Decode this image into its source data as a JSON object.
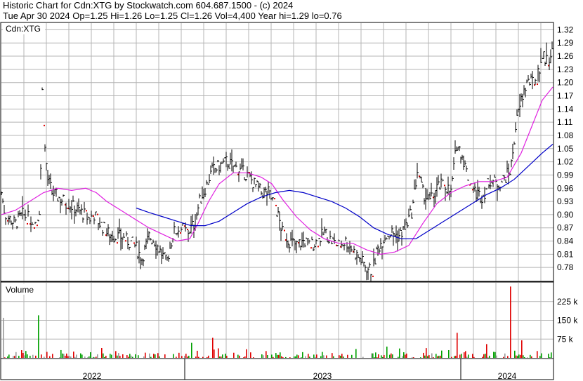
{
  "header": {
    "line1": "Historic Chart for Cdn:XTG by Stockwatch.com 604.687.1500 - (c) 2024",
    "line2": "Tue Apr 30 2024  Op=1.25  Hi=1.26  Lo=1.25  Cl=1.26  Vol=4,400  Year hi=1.29  lo=0.76"
  },
  "chart_data": [
    {
      "type": "ohlc",
      "panel_label": "Cdn:XTG",
      "y_ticks": [
        "1.32",
        "1.29",
        "1.26",
        "1.23",
        "1.20",
        "1.17",
        "1.14",
        "1.11",
        "1.08",
        "1.05",
        "1.02",
        "0.99",
        "0.96",
        "0.93",
        "0.90",
        "0.87",
        "0.84",
        "0.81",
        "0.78"
      ],
      "ylim": [
        0.75,
        1.335
      ],
      "grid": true,
      "colors": {
        "price_bar": "#000000",
        "down_dot": "#e00000",
        "ma_short": "#e020e0",
        "ma_long": "#0000c8",
        "grid": "#b4b4b4"
      },
      "price_path": [
        [
          0,
          0.95
        ],
        [
          5,
          0.9
        ],
        [
          12,
          0.89
        ],
        [
          20,
          0.88
        ],
        [
          30,
          0.9
        ],
        [
          40,
          0.89
        ],
        [
          50,
          0.88
        ],
        [
          55,
          0.92
        ],
        [
          58,
          1.18
        ],
        [
          62,
          1.05
        ],
        [
          66,
          0.98
        ],
        [
          72,
          0.95
        ],
        [
          80,
          0.94
        ],
        [
          90,
          0.93
        ],
        [
          100,
          0.92
        ],
        [
          110,
          0.91
        ],
        [
          118,
          0.9
        ],
        [
          125,
          0.89
        ],
        [
          132,
          0.9
        ],
        [
          140,
          0.88
        ],
        [
          150,
          0.86
        ],
        [
          160,
          0.85
        ],
        [
          170,
          0.85
        ],
        [
          180,
          0.84
        ],
        [
          190,
          0.83
        ],
        [
          200,
          0.8
        ],
        [
          210,
          0.85
        ],
        [
          218,
          0.84
        ],
        [
          225,
          0.82
        ],
        [
          235,
          0.79
        ],
        [
          245,
          0.86
        ],
        [
          255,
          0.87
        ],
        [
          265,
          0.86
        ],
        [
          275,
          0.88
        ],
        [
          282,
          0.93
        ],
        [
          290,
          0.96
        ],
        [
          300,
          1.0
        ],
        [
          310,
          1.01
        ],
        [
          320,
          1.02
        ],
        [
          330,
          1.01
        ],
        [
          340,
          1.0
        ],
        [
          350,
          0.99
        ],
        [
          360,
          0.97
        ],
        [
          370,
          0.95
        ],
        [
          380,
          0.95
        ],
        [
          390,
          0.92
        ],
        [
          400,
          0.86
        ],
        [
          410,
          0.84
        ],
        [
          420,
          0.83
        ],
        [
          430,
          0.84
        ],
        [
          440,
          0.83
        ],
        [
          450,
          0.84
        ],
        [
          460,
          0.86
        ],
        [
          470,
          0.84
        ],
        [
          480,
          0.83
        ],
        [
          490,
          0.84
        ],
        [
          500,
          0.82
        ],
        [
          510,
          0.8
        ],
        [
          520,
          0.78
        ],
        [
          528,
          0.77
        ],
        [
          535,
          0.82
        ],
        [
          545,
          0.85
        ],
        [
          555,
          0.86
        ],
        [
          565,
          0.85
        ],
        [
          575,
          0.87
        ],
        [
          585,
          0.91
        ],
        [
          592,
          1.0
        ],
        [
          600,
          0.95
        ],
        [
          610,
          0.93
        ],
        [
          620,
          0.96
        ],
        [
          630,
          0.97
        ],
        [
          640,
          0.95
        ],
        [
          648,
          1.06
        ],
        [
          655,
          1.04
        ],
        [
          665,
          0.98
        ],
        [
          675,
          0.95
        ],
        [
          685,
          0.94
        ],
        [
          695,
          0.98
        ],
        [
          705,
          0.97
        ],
        [
          715,
          0.98
        ],
        [
          725,
          1.0
        ],
        [
          732,
          1.1
        ],
        [
          740,
          1.16
        ],
        [
          748,
          1.2
        ],
        [
          755,
          1.2
        ],
        [
          762,
          1.21
        ],
        [
          770,
          1.26
        ],
        [
          778,
          1.25
        ],
        [
          784,
          1.27
        ],
        [
          788,
          1.26
        ]
      ],
      "ma_short": [
        [
          0,
          0.9
        ],
        [
          20,
          0.91
        ],
        [
          40,
          0.93
        ],
        [
          60,
          0.95
        ],
        [
          80,
          0.96
        ],
        [
          100,
          0.955
        ],
        [
          120,
          0.96
        ],
        [
          135,
          0.95
        ],
        [
          150,
          0.93
        ],
        [
          170,
          0.91
        ],
        [
          190,
          0.89
        ],
        [
          210,
          0.87
        ],
        [
          230,
          0.855
        ],
        [
          250,
          0.84
        ],
        [
          268,
          0.845
        ],
        [
          280,
          0.88
        ],
        [
          295,
          0.93
        ],
        [
          310,
          0.97
        ],
        [
          330,
          0.995
        ],
        [
          350,
          0.995
        ],
        [
          370,
          0.985
        ],
        [
          385,
          0.97
        ],
        [
          400,
          0.935
        ],
        [
          420,
          0.895
        ],
        [
          440,
          0.865
        ],
        [
          460,
          0.845
        ],
        [
          480,
          0.835
        ],
        [
          500,
          0.835
        ],
        [
          520,
          0.82
        ],
        [
          540,
          0.81
        ],
        [
          560,
          0.815
        ],
        [
          580,
          0.83
        ],
        [
          600,
          0.88
        ],
        [
          620,
          0.925
        ],
        [
          640,
          0.95
        ],
        [
          660,
          0.965
        ],
        [
          680,
          0.975
        ],
        [
          700,
          0.975
        ],
        [
          720,
          0.985
        ],
        [
          740,
          1.04
        ],
        [
          755,
          1.1
        ],
        [
          770,
          1.16
        ],
        [
          785,
          1.19
        ]
      ],
      "ma_long": [
        [
          192,
          0.915
        ],
        [
          210,
          0.905
        ],
        [
          230,
          0.895
        ],
        [
          250,
          0.885
        ],
        [
          270,
          0.875
        ],
        [
          290,
          0.875
        ],
        [
          310,
          0.885
        ],
        [
          330,
          0.905
        ],
        [
          350,
          0.925
        ],
        [
          370,
          0.94
        ],
        [
          390,
          0.95
        ],
        [
          410,
          0.955
        ],
        [
          430,
          0.95
        ],
        [
          450,
          0.94
        ],
        [
          470,
          0.93
        ],
        [
          490,
          0.915
        ],
        [
          510,
          0.895
        ],
        [
          530,
          0.87
        ],
        [
          550,
          0.855
        ],
        [
          570,
          0.845
        ],
        [
          590,
          0.845
        ],
        [
          610,
          0.865
        ],
        [
          630,
          0.885
        ],
        [
          650,
          0.905
        ],
        [
          670,
          0.925
        ],
        [
          690,
          0.945
        ],
        [
          710,
          0.96
        ],
        [
          730,
          0.98
        ],
        [
          750,
          1.01
        ],
        [
          770,
          1.04
        ],
        [
          785,
          1.06
        ]
      ]
    },
    {
      "type": "bar",
      "panel_label": "Volume",
      "y_ticks": [
        "225 k",
        "150 k",
        "75 k"
      ],
      "ylim": [
        0,
        300000
      ],
      "colors": {
        "up": "#00a000",
        "down": "#e00000",
        "flat": "#9a9a9a"
      },
      "notable_bars": [
        [
          2,
          160000
        ],
        [
          52,
          170000
        ],
        [
          270,
          60000
        ],
        [
          300,
          80000
        ],
        [
          548,
          45000
        ],
        [
          648,
          100000
        ],
        [
          690,
          55000
        ],
        [
          724,
          285000
        ],
        [
          740,
          70000
        ]
      ]
    }
  ],
  "x_axis": {
    "labels": [
      "2022",
      "2023",
      "2024"
    ]
  }
}
